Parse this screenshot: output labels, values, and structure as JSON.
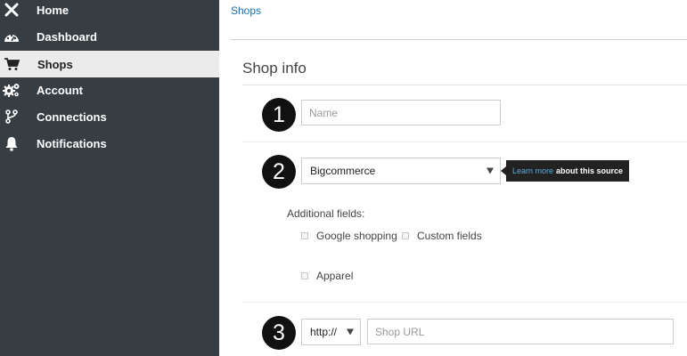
{
  "sidebar": {
    "items": [
      {
        "label": "Home",
        "icon": "close-icon"
      },
      {
        "label": "Dashboard",
        "icon": "dashboard-icon"
      },
      {
        "label": "Shops",
        "icon": "cart-icon",
        "active": true
      },
      {
        "label": "Account",
        "icon": "gears-icon"
      },
      {
        "label": "Connections",
        "icon": "branch-icon"
      },
      {
        "label": "Notifications",
        "icon": "bell-icon"
      }
    ]
  },
  "main": {
    "breadcrumb": "Shops",
    "title": "Shop info",
    "steps": [
      "1",
      "2",
      "3"
    ],
    "name_field": {
      "placeholder": "Name"
    },
    "source_select": {
      "value": "Bigcommerce"
    },
    "tooltip": {
      "link": "Learn more",
      "text": "about this source"
    },
    "additional_fields": {
      "label": "Additional fields:",
      "options": [
        "Google shopping",
        "Custom fields",
        "Apparel"
      ]
    },
    "protocol_select": {
      "value": "http://"
    },
    "url_field": {
      "placeholder": "Shop URL"
    }
  },
  "colors": {
    "sidebar_bg": "#363d43",
    "active_bg": "#ebebeb",
    "link": "#1a6fb0",
    "tooltip_bg": "#222222"
  }
}
